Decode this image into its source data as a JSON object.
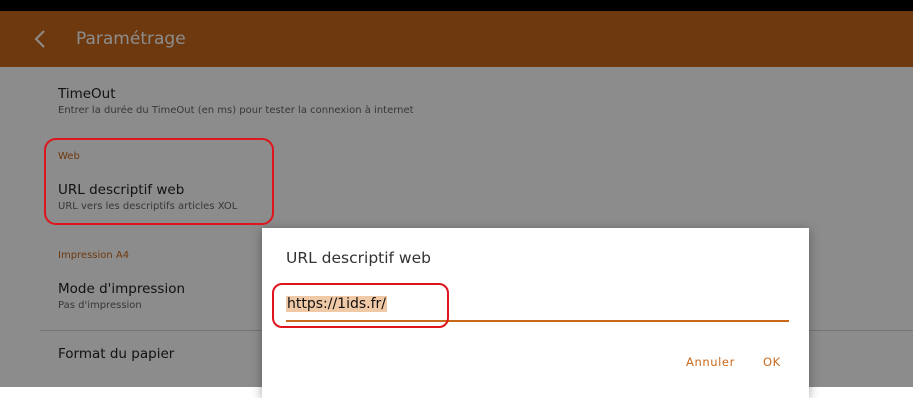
{
  "appbar": {
    "title": "Paramétrage"
  },
  "settings": {
    "timeout": {
      "title": "TimeOut",
      "subtitle": "Entrer la durée du TimeOut (en ms) pour tester la connexion à internet"
    },
    "web": {
      "section": "Web",
      "title": "URL descriptif web",
      "subtitle": "URL vers les descriptifs articles XOL"
    },
    "impression": {
      "section": "Impression A4",
      "mode_title": "Mode d'impression",
      "mode_subtitle": "Pas d'impression",
      "format_title": "Format du papier"
    }
  },
  "dialog": {
    "title": "URL descriptif web",
    "input_value": "https://1ids.fr/",
    "cancel_label": "Annuler",
    "ok_label": "OK"
  },
  "colors": {
    "accent": "#c9691c",
    "annotation": "#e0141c"
  }
}
